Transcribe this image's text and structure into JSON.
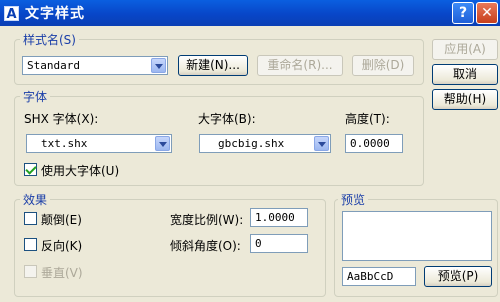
{
  "window": {
    "title": "文字样式",
    "app_icon": "A"
  },
  "titlebar_buttons": {
    "help": "?",
    "close": "✕"
  },
  "style_name": {
    "group_label": "样式名(S)",
    "selected": "Standard",
    "new_button": "新建(N)...",
    "rename_button": "重命名(R)...",
    "delete_button": "删除(D)"
  },
  "right_buttons": {
    "apply": "应用(A)",
    "cancel": "取消",
    "help": "帮助(H)"
  },
  "font": {
    "group_label": "字体",
    "shx_font_label": "SHX 字体(X):",
    "shx_font_value": "txt.shx",
    "big_font_label": "大字体(B):",
    "big_font_value": "gbcbig.shx",
    "height_label": "高度(T):",
    "height_value": "0.0000",
    "use_big_font_label": "使用大字体(U)",
    "use_big_font_checked": true
  },
  "effects": {
    "group_label": "效果",
    "upside_down_label": "颠倒(E)",
    "backwards_label": "反向(K)",
    "vertical_label": "垂直(V)",
    "width_factor_label": "宽度比例(W):",
    "width_factor_value": "1.0000",
    "oblique_angle_label": "倾斜角度(O):",
    "oblique_angle_value": "0"
  },
  "preview": {
    "group_label": "预览",
    "sample_text": "AaBbCcD",
    "preview_button": "预览(P)"
  }
}
